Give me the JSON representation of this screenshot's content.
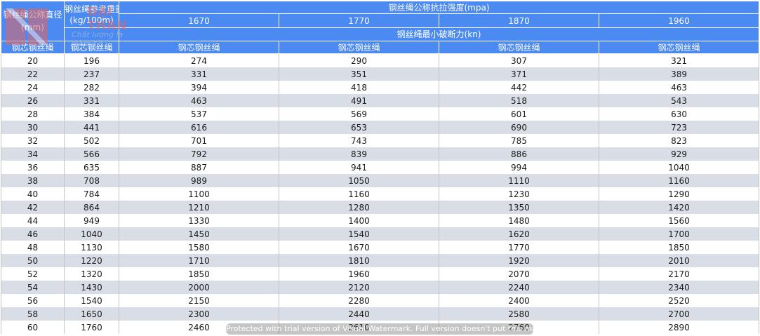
{
  "header": {
    "diameter": "钢丝绳公称直径(mm)",
    "weight_line1": "钢丝绳参考重量",
    "weight_line2": "(kg/100m)",
    "strength_title": "钢丝绳公称抗拉强度(mpa)",
    "grades": [
      "1670",
      "1770",
      "1870",
      "1960"
    ],
    "breaking_title": "钢丝绳最小破断力(kn)",
    "core_label": "钢芯钢丝绳"
  },
  "rows": [
    [
      "20",
      "196",
      "274",
      "290",
      "307",
      "321"
    ],
    [
      "22",
      "237",
      "331",
      "351",
      "371",
      "389"
    ],
    [
      "24",
      "282",
      "394",
      "418",
      "442",
      "463"
    ],
    [
      "26",
      "331",
      "463",
      "491",
      "518",
      "543"
    ],
    [
      "28",
      "384",
      "537",
      "569",
      "601",
      "630"
    ],
    [
      "30",
      "441",
      "616",
      "653",
      "690",
      "723"
    ],
    [
      "32",
      "502",
      "701",
      "743",
      "785",
      "823"
    ],
    [
      "34",
      "566",
      "792",
      "839",
      "886",
      "929"
    ],
    [
      "36",
      "635",
      "887",
      "941",
      "994",
      "1040"
    ],
    [
      "38",
      "708",
      "989",
      "1050",
      "1110",
      "1160"
    ],
    [
      "40",
      "784",
      "1100",
      "1160",
      "1230",
      "1290"
    ],
    [
      "42",
      "864",
      "1210",
      "1280",
      "1350",
      "1420"
    ],
    [
      "44",
      "949",
      "1330",
      "1400",
      "1480",
      "1560"
    ],
    [
      "46",
      "1040",
      "1450",
      "1540",
      "1620",
      "1700"
    ],
    [
      "48",
      "1130",
      "1580",
      "1670",
      "1770",
      "1850"
    ],
    [
      "50",
      "1220",
      "1710",
      "1810",
      "1920",
      "2010"
    ],
    [
      "52",
      "1320",
      "1850",
      "1960",
      "2070",
      "2170"
    ],
    [
      "54",
      "1430",
      "2000",
      "2120",
      "2240",
      "2340"
    ],
    [
      "56",
      "1540",
      "2150",
      "2280",
      "2400",
      "2520"
    ],
    [
      "58",
      "1650",
      "2300",
      "2440",
      "2580",
      "2700"
    ],
    [
      "60",
      "1760",
      "2460",
      "2610",
      "2760",
      "2890"
    ]
  ],
  "logo": {
    "name": "ĐẠI THÀN",
    "tagline": "Chất lượng là niềm tin",
    "color": "#e06666"
  },
  "watermark": "Protected with trial version of Visual Watermark. Full version doesn't put this mark.",
  "colors": {
    "header_bg": "#4b8af0",
    "stripe": "#d9dde6"
  }
}
